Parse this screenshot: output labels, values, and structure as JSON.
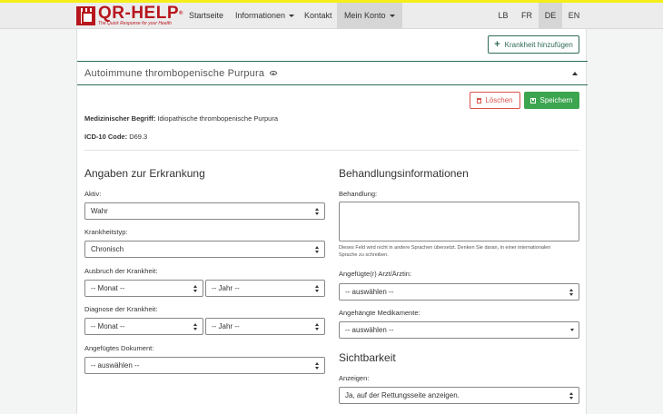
{
  "brand": {
    "logo_text": "QR-HELP",
    "logo_reg": "®",
    "tagline": "The Quick Response for your Health"
  },
  "nav": {
    "items": [
      {
        "label": "Startseite",
        "dropdown": false
      },
      {
        "label": "Informationen",
        "dropdown": true
      },
      {
        "label": "Kontakt",
        "dropdown": false
      },
      {
        "label": "Mein Konto",
        "dropdown": true
      }
    ],
    "active": "Mein Konto",
    "languages": [
      "LB",
      "FR",
      "DE",
      "EN"
    ],
    "active_language": "DE"
  },
  "toolbar": {
    "add_disease_label": "Krankheit hinzufügen"
  },
  "disease": {
    "title": "Autoimmune thrombopenische Purpura",
    "delete_label": "Löschen",
    "save_label": "Speichern",
    "medical_term_label": "Medizinischer Begriff:",
    "medical_term_value": "Idiopathische thrombopenische Purpura",
    "icd_label": "ICD-10 Code:",
    "icd_value": "D69.3"
  },
  "left": {
    "section_title": "Angaben zur Erkrankung",
    "active_label": "Aktiv:",
    "active_value": "Wahr",
    "type_label": "Krankheitstyp:",
    "type_value": "Chronisch",
    "onset_label": "Ausbruch der Krankheit:",
    "onset_month": "-- Monat --",
    "onset_year": "-- Jahr --",
    "diagnosis_label": "Diagnose der Krankheit:",
    "diagnosis_month": "-- Monat --",
    "diagnosis_year": "-- Jahr --",
    "document_label": "Angefügtes Dokument:",
    "document_value": "-- auswählen --"
  },
  "right": {
    "section_title": "Behandlungsinformationen",
    "treatment_label": "Behandlung:",
    "treatment_hint": "Dieses Feld wird nicht in andere Sprachen übersetzt. Denken Sie daran, in einer internationalen Sprache zu schreiben.",
    "doctor_label": "Angefügte(r) Arzt/Ärztin:",
    "doctor_value": "-- auswählen --",
    "meds_label": "Angehängte Medikamente:",
    "meds_value": "-- auswählen --",
    "visibility_title": "Sichtbarkeit",
    "show_label": "Anzeigen:",
    "show_value": "Ja, auf der Rettungsseite anzeigen."
  },
  "colors": {
    "accent": "#2e6b57",
    "brand_red": "#b8161d",
    "danger": "#d9534f",
    "success": "#3ca550",
    "top_stripe": "#f5ee1a"
  }
}
